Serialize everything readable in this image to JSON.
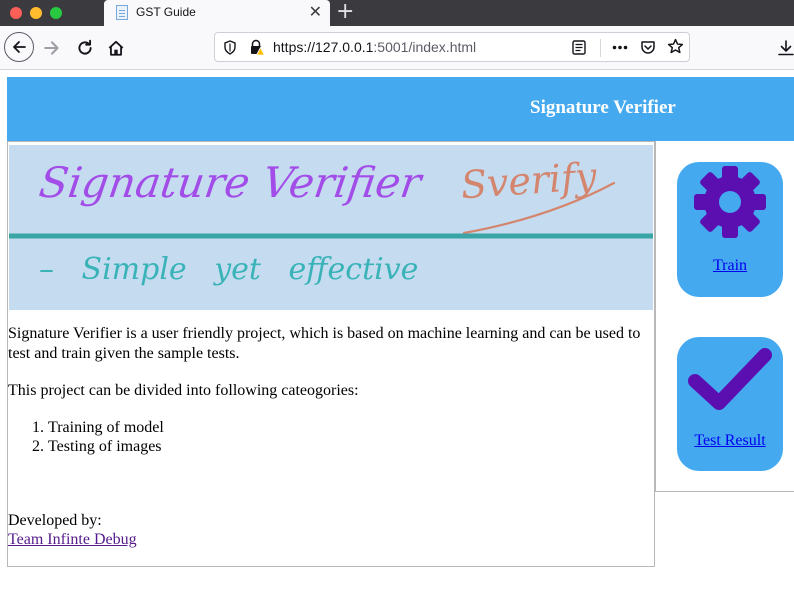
{
  "browser": {
    "tab_title": "GST Guide",
    "tab_close": "✕",
    "new_tab": "+",
    "url_domain": "https://127.0.0.1",
    "url_rest": ":5001/index.html"
  },
  "header": {
    "title": "Signature Verifier"
  },
  "banner": {
    "handwritten_title": "Signature Verifier",
    "handwritten_signature": "Sverify",
    "handwritten_tagline": "– Simple yet effective"
  },
  "content": {
    "description": "Signature Verifier is a user friendly project, which is based on machine learning and can be used to test and train given the sample tests.",
    "intro": "This project can be divided into following cateogories:",
    "categories": [
      "Training of model",
      "Testing of images"
    ],
    "developed_by_label": "Developed by:",
    "developer_link": "Team Infinte Debug"
  },
  "sidebar": {
    "train_label": "Train",
    "test_label": "Test Result",
    "train_icon": "gear-icon",
    "test_icon": "checkmark-icon"
  },
  "colors": {
    "header_bg": "#45a9f0",
    "icon_purple": "#5b0fb0",
    "banner_bg": "#c5dcf0"
  }
}
